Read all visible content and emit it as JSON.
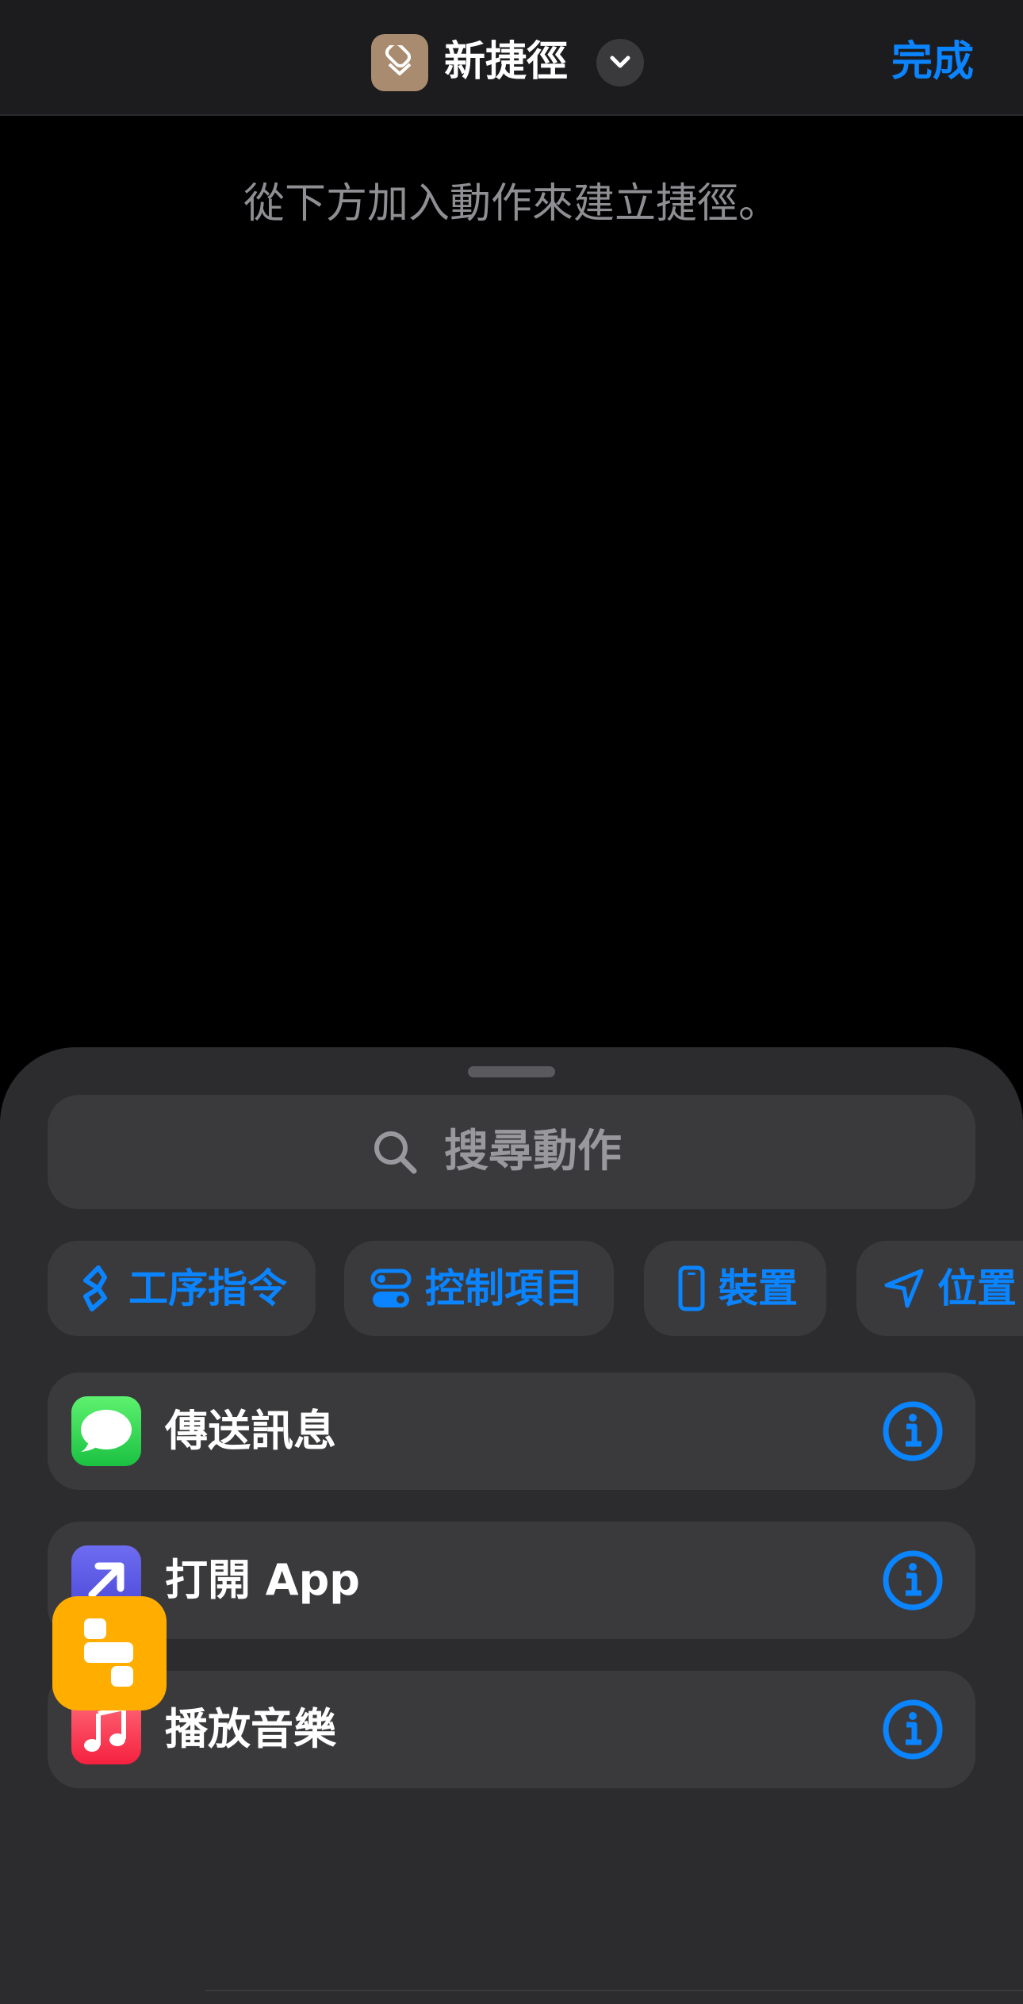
{
  "header": {
    "title": "新捷徑",
    "done_label": "完成",
    "app_icon": "shortcuts-icon",
    "title_menu_icon": "chevron-down-icon"
  },
  "hint": "從下方加入動作來建立捷徑。",
  "sheet": {
    "search_placeholder": "搜尋動作",
    "categories": [
      {
        "label": "工序指令",
        "icon": "script-icon"
      },
      {
        "label": "控制項目",
        "icon": "toggles-icon"
      },
      {
        "label": "裝置",
        "icon": "iphone-icon"
      },
      {
        "label": "位置",
        "icon": "location-arrow-icon"
      }
    ],
    "actions": [
      {
        "label": "傳送訊息",
        "icon": "messages-icon",
        "info_icon": "info-icon"
      },
      {
        "label": "打開 App",
        "icon": "open-app-arrow-icon",
        "info_icon": "info-icon"
      },
      {
        "label": "播放音樂",
        "icon": "music-note-icon",
        "info_icon": "info-icon"
      }
    ],
    "bottom_app_icon": "app-blocks-icon"
  },
  "colors": {
    "accent": "#0a84ff",
    "background": "#000000",
    "header": "#1c1c1e",
    "sheet": "#2c2c2e",
    "row": "#3a3a3c",
    "shortcuts_icon": "#a98b70",
    "messages_green": "#30d158",
    "open_app_purple": "#5e5ce6",
    "music_red": "#fc3c44",
    "bottom_tile_yellow": "#ffae00"
  }
}
